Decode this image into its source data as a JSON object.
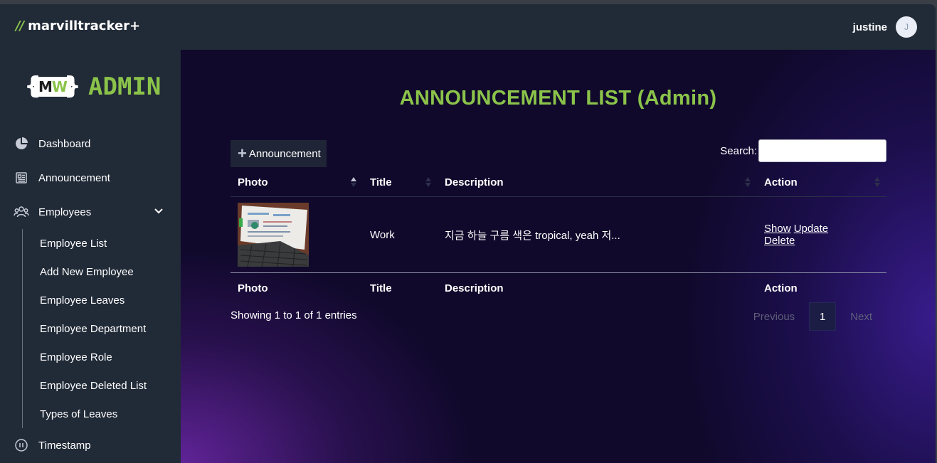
{
  "app": {
    "brand_slashes": "//",
    "brand_name": "marvilltracker+",
    "user_name": "justine",
    "user_initial": "J"
  },
  "sidebar": {
    "logo_letters": "MW",
    "logo_text": "ADMIN",
    "items": [
      {
        "label": "Dashboard",
        "icon": "pie-chart-icon"
      },
      {
        "label": "Announcement",
        "icon": "newspaper-icon"
      },
      {
        "label": "Employees",
        "icon": "users-icon",
        "expanded": true
      }
    ],
    "employee_subitems": [
      "Employee List",
      "Add New Employee",
      "Employee Leaves",
      "Employee Department",
      "Employee Role",
      "Employee Deleted List",
      "Types of Leaves"
    ],
    "timestamp": {
      "label": "Timestamp",
      "icon": "pause-circle-icon"
    }
  },
  "main": {
    "title": "ANNOUNCEMENT LIST (Admin)",
    "add_button_label": "Announcement",
    "search_label": "Search:",
    "search_value": "",
    "columns": [
      "Photo",
      "Title",
      "Description",
      "Action"
    ],
    "rows": [
      {
        "photo": "announcement-photo",
        "title": "Work",
        "description": "지금 하늘 구름 색은 tropical, yeah 저...",
        "actions": [
          "Show",
          "Update",
          "Delete"
        ]
      }
    ],
    "info": "Showing 1 to 1 of 1 entries",
    "pagination": {
      "previous": "Previous",
      "current": "1",
      "next": "Next"
    }
  },
  "colors": {
    "accent_green": "#8bc34a",
    "sidebar_bg": "#212a37",
    "main_bg": "#10092b"
  }
}
